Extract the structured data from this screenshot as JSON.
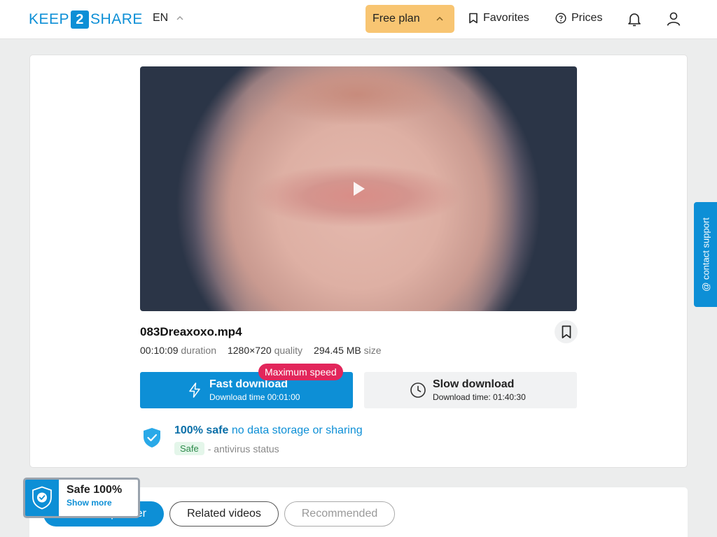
{
  "header": {
    "logo": {
      "pre": "KEEP",
      "mid": "2",
      "post": "SHARE"
    },
    "language": "EN",
    "plan_label": "Free plan",
    "favorites_label": "Favorites",
    "prices_label": "Prices",
    "icons": {
      "favorites": "bookmark-icon",
      "prices": "help-circle-icon",
      "notifications": "bell-icon",
      "profile": "user-icon"
    }
  },
  "file": {
    "name": "083Dreaxoxo.mp4",
    "duration": "00:10:09",
    "duration_label": "duration",
    "quality": "1280×720",
    "quality_label": "quality",
    "size": "294.45 MB",
    "size_label": "size"
  },
  "download": {
    "fast_title": "Fast download",
    "fast_sub": "Download time 00:01:00",
    "max_speed_badge": "Maximum speed",
    "slow_title": "Slow download",
    "slow_sub": "Download time: 01:40:30"
  },
  "safety": {
    "headline_bold": "100% safe",
    "headline_rest": "no data storage or sharing",
    "badge": "Safe",
    "status_text": "- antivirus status"
  },
  "support_tab": "@ contact support",
  "tabs": [
    {
      "label": "From this partner"
    },
    {
      "label": "Related videos"
    },
    {
      "label": "Recommended"
    }
  ],
  "safe_badge": {
    "title": "Safe 100%",
    "link": "Show more"
  },
  "colors": {
    "brand": "#0d8fd6",
    "plan": "#f8c572",
    "max_speed": "#e2265b"
  }
}
